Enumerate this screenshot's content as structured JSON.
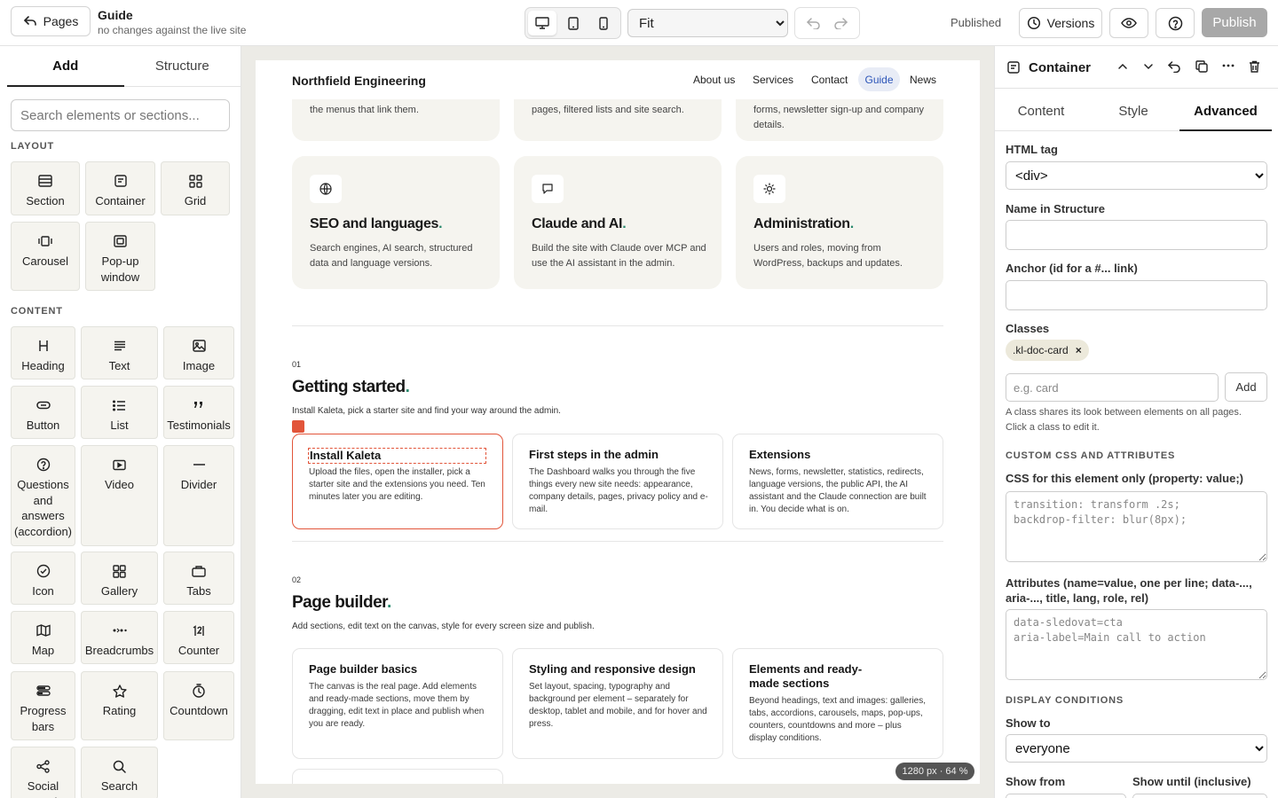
{
  "topbar": {
    "back_label": "Pages",
    "title": "Guide",
    "subtitle": "no changes against the live site",
    "zoom_options": [
      "Fit"
    ],
    "status": "Published",
    "versions_label": "Versions",
    "publish_label": "Publish"
  },
  "left_panel": {
    "tabs": [
      "Add",
      "Structure"
    ],
    "search_placeholder": "Search elements or sections...",
    "layout_heading": "LAYOUT",
    "content_heading": "CONTENT",
    "layout_items": [
      {
        "label": "Section",
        "icon": "section-icon"
      },
      {
        "label": "Container",
        "icon": "container-icon"
      },
      {
        "label": "Grid",
        "icon": "grid-icon"
      },
      {
        "label": "Carousel",
        "icon": "carousel-icon"
      },
      {
        "label": "Pop-up window",
        "icon": "popup-icon"
      }
    ],
    "content_items": [
      {
        "label": "Heading",
        "icon": "heading-icon"
      },
      {
        "label": "Text",
        "icon": "text-icon"
      },
      {
        "label": "Image",
        "icon": "image-icon"
      },
      {
        "label": "Button",
        "icon": "button-icon"
      },
      {
        "label": "List",
        "icon": "list-icon"
      },
      {
        "label": "Testimonials",
        "icon": "quote-icon"
      },
      {
        "label": "Questions and answers (accordion)",
        "icon": "question-icon"
      },
      {
        "label": "Video",
        "icon": "video-icon"
      },
      {
        "label": "Divider",
        "icon": "divider-icon"
      },
      {
        "label": "Icon",
        "icon": "check-circle-icon"
      },
      {
        "label": "Gallery",
        "icon": "gallery-icon"
      },
      {
        "label": "Tabs",
        "icon": "tabs-icon"
      },
      {
        "label": "Map",
        "icon": "map-icon"
      },
      {
        "label": "Breadcrumbs",
        "icon": "breadcrumbs-icon"
      },
      {
        "label": "Counter",
        "icon": "counter-icon"
      },
      {
        "label": "Progress bars",
        "icon": "progress-icon"
      },
      {
        "label": "Rating",
        "icon": "star-icon"
      },
      {
        "label": "Countdown",
        "icon": "clock-icon"
      },
      {
        "label": "Social networks",
        "icon": "share-icon"
      },
      {
        "label": "Search",
        "icon": "search-icon"
      }
    ]
  },
  "site": {
    "brand": "Northfield Engineering",
    "nav": [
      "About us",
      "Services",
      "Contact",
      "Guide",
      "News"
    ],
    "nav_active": "Guide",
    "top_cards": [
      "the menus that link them.",
      "pages, filtered lists and site search.",
      "forms, newsletter sign-up and company details."
    ],
    "feature_cards": [
      {
        "title": "SEO and languages",
        "desc": "Search engines, AI search, structured data and language versions.",
        "icon": "globe-icon"
      },
      {
        "title": "Claude and AI",
        "desc": "Build the site with Claude over MCP and use the AI assistant in the admin.",
        "icon": "chat-icon"
      },
      {
        "title": "Administration",
        "desc": "Users and roles, moving from WordPress, backups and updates.",
        "icon": "sun-icon"
      }
    ],
    "sections": [
      {
        "num": "01",
        "title": "Getting started",
        "desc": "Install Kaleta, pick a starter site and find your way around the admin.",
        "cards": [
          {
            "title": "Install Kaleta",
            "desc": "Upload the files, open the installer, pick a starter site and the extensions you need. Ten minutes later you are editing."
          },
          {
            "title": "First steps in the admin",
            "desc": "The Dashboard walks you through the five things every new site needs: appearance, company details, pages, privacy policy and e-mail."
          },
          {
            "title": "Extensions",
            "desc": "News, forms, newsletter, statistics, redirects, language versions, the public API, the AI assistant and the Claude connection are built in. You decide what is on."
          }
        ]
      },
      {
        "num": "02",
        "title": "Page builder",
        "desc": "Add sections, edit text on the canvas, style for every screen size and publish.",
        "cards": [
          {
            "title": "Page builder basics",
            "desc": "The canvas is the real page. Add elements and ready-made sections, move them by dragging, edit text in place and publish when you are ready."
          },
          {
            "title": "Styling and responsive design",
            "desc": "Set layout, spacing, typography and background per element – separately for desktop, tablet and mobile, and for hover and press."
          },
          {
            "title": "Elements and ready-made sections",
            "desc": "Beyond headings, text and images: galleries, tabs, accordions, carousels, maps, pop-ups, counters, countdowns and more – plus display conditions."
          }
        ]
      }
    ],
    "title_dot": "."
  },
  "canvas": {
    "zoom_badge": "1280 px · 64 %"
  },
  "right_panel": {
    "title": "Container",
    "tabs": [
      "Content",
      "Style",
      "Advanced"
    ],
    "active_tab": "Advanced",
    "html_tag_label": "HTML tag",
    "html_tag_value": "<div>",
    "name_label": "Name in Structure",
    "name_value": "",
    "anchor_label": "Anchor (id for a #... link)",
    "anchor_value": "",
    "classes_label": "Classes",
    "class_chip": ".kl-doc-card",
    "class_chip_remove": "×",
    "class_placeholder": "e.g. card",
    "class_add_label": "Add",
    "class_help": "A class shares its look between elements on all pages. Click a class to edit it.",
    "custom_heading": "CUSTOM CSS AND ATTRIBUTES",
    "css_label": "CSS for this element only (property: value;)",
    "css_placeholder": "transition: transform .2s;\nbackdrop-filter: blur(8px);",
    "attrs_label": "Attributes (name=value, one per line; data-..., aria-..., title, lang, role, rel)",
    "attrs_placeholder": "data-sledovat=cta\naria-label=Main call to action",
    "display_heading": "DISPLAY CONDITIONS",
    "show_to_label": "Show to",
    "show_to_value": "everyone",
    "show_from_label": "Show from",
    "show_until_label": "Show until (inclusive)"
  }
}
